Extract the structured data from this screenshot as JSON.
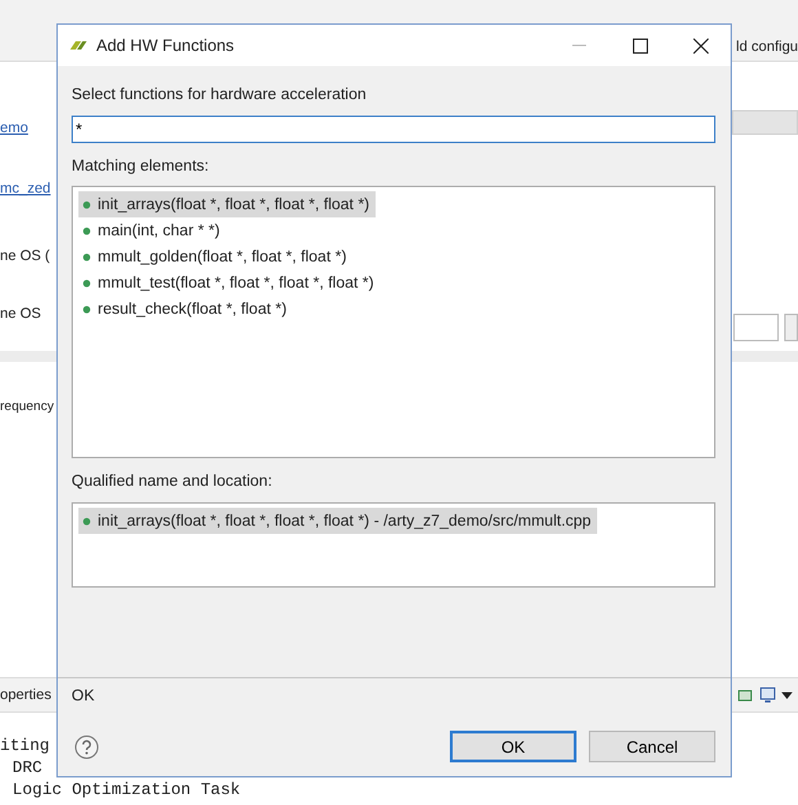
{
  "ide": {
    "toolbar_text": "ld configu",
    "side_items": [
      {
        "kind": "link",
        "text": "emo"
      },
      {
        "kind": "link",
        "text": "mc_zed"
      },
      {
        "kind": "label",
        "text": "ne OS ("
      },
      {
        "kind": "label",
        "text": "ne OS"
      }
    ],
    "section_text": "requency",
    "panel_tab": "operties",
    "console_lines": [
      "iting",
      "DRC",
      "Logic Optimization Task"
    ]
  },
  "dialog": {
    "title": "Add HW Functions",
    "prompt": "Select functions for hardware acceleration",
    "filter": {
      "value": "*"
    },
    "matching_label": "Matching elements:",
    "matches": [
      {
        "text": "init_arrays(float *, float *, float *, float *)",
        "selected": true
      },
      {
        "text": "main(int, char * *)",
        "selected": false
      },
      {
        "text": "mmult_golden(float *, float *, float *)",
        "selected": false
      },
      {
        "text": "mmult_test(float *, float *, float *, float *)",
        "selected": false
      },
      {
        "text": "result_check(float *, float *)",
        "selected": false
      }
    ],
    "qualified_label": "Qualified name and location:",
    "qualified": [
      {
        "text": "init_arrays(float *, float *, float *, float *) - /arty_z7_demo/src/mmult.cpp",
        "selected": true
      }
    ],
    "status": "OK",
    "buttons": [
      {
        "label": "OK",
        "default": true
      },
      {
        "label": "Cancel",
        "default": false
      }
    ]
  }
}
